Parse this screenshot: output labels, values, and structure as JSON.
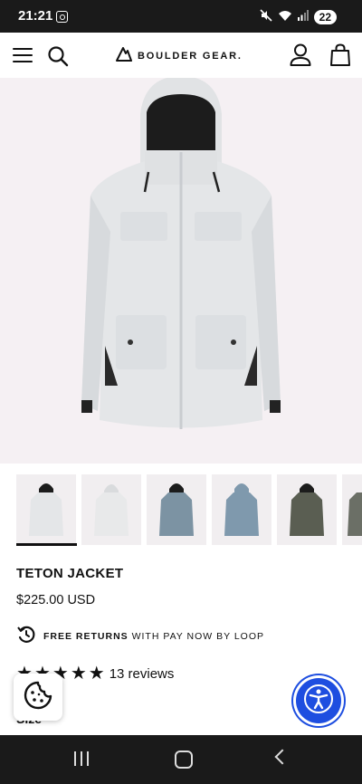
{
  "status_bar": {
    "time": "21:21",
    "battery": "22"
  },
  "header": {
    "brand": "BOULDER GEAR."
  },
  "product": {
    "title": "TETON JACKET",
    "price": "$225.00 USD",
    "returns_bold": "FREE RETURNS",
    "returns_rest": "WITH PAY NOW BY LOOP",
    "rating_stars": 5,
    "reviews": "13 reviews",
    "size_label": "Size"
  },
  "colors": {
    "jacket_main": "#e4e6e8",
    "jacket_shadow": "#c9ccd0",
    "swatches": [
      "#e4e6e8",
      "#e8e9ea",
      "#7c93a3",
      "#7f99ad",
      "#5a5e52",
      "#6b6f66"
    ],
    "accent_blue": "#1e4ee0"
  },
  "icons": [
    "hamburger-menu-icon",
    "search-icon",
    "boulder-gear-logo-icon",
    "user-icon",
    "shopping-bag-icon",
    "loop-returns-icon",
    "star-icon",
    "cookie-icon",
    "accessibility-icon"
  ]
}
